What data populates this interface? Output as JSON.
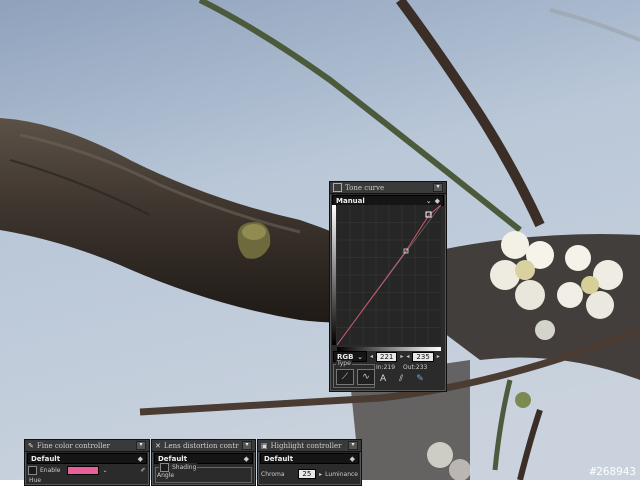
{
  "tone_curve": {
    "title": "Tone curve",
    "preset": "Manual",
    "channel": "RGB",
    "value_left": "221",
    "value_right": "235",
    "type_label": "Type",
    "in_label": "In:219",
    "out_label": "Out:233"
  },
  "bottom_panels": [
    {
      "title": "Fine color controller",
      "preset": "Default",
      "enable_label": "Enable",
      "hue_label": "Hue",
      "swatch_color": "#e8609a"
    },
    {
      "title": "Lens distortion controller",
      "preset": "Default",
      "shading_label": "Shading",
      "angle_label": "Angle"
    },
    {
      "title": "Highlight controller",
      "preset": "Default",
      "chroma_label": "Chroma",
      "chroma_value": "25",
      "luminance_label": "Luminance"
    }
  ],
  "image_id": "#268943"
}
